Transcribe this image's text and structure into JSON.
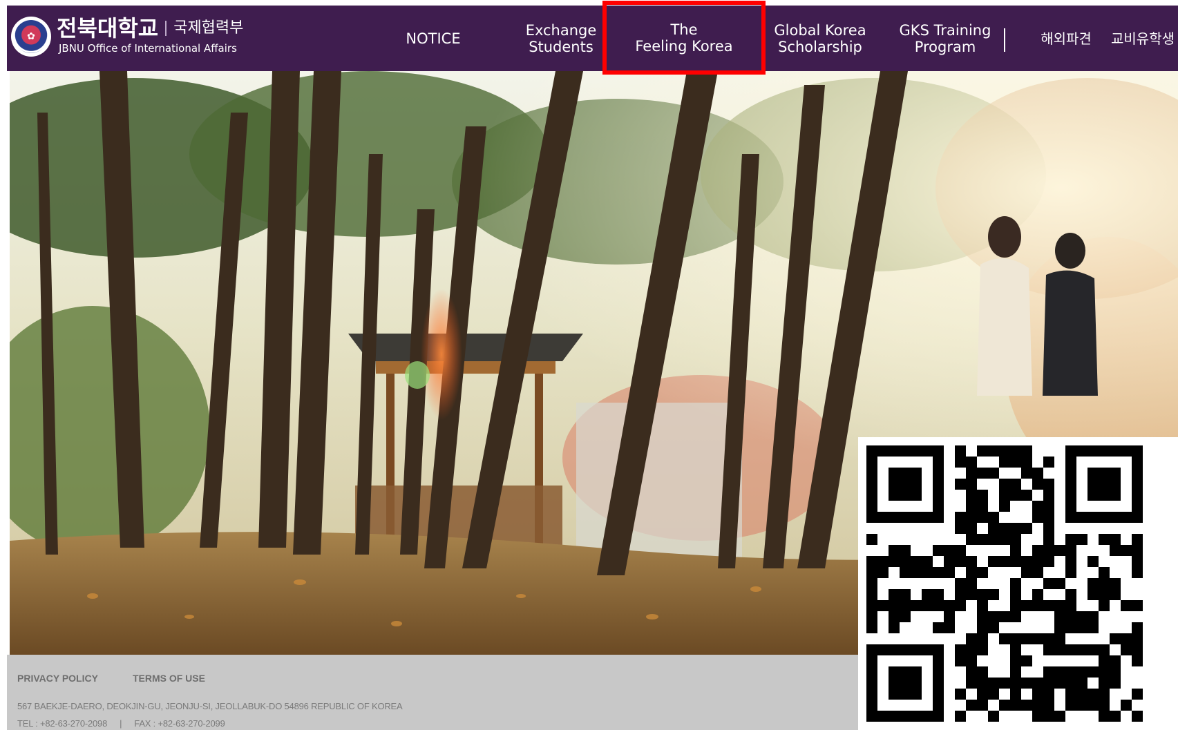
{
  "header": {
    "logo": {
      "univ_name": "전북대학교",
      "dept_name": "국제협력부",
      "english_name": "JBNU Office of International Affairs",
      "emblem_icon": "university-emblem-icon"
    },
    "nav": [
      {
        "label": "NOTICE"
      },
      {
        "label": "Exchange\nStudents"
      },
      {
        "label": "The\nFeeling Korea",
        "highlighted": true
      },
      {
        "label": "Global Korea\nScholarship"
      },
      {
        "label": "GKS Training\nProgram"
      },
      {
        "label": "해외파견"
      },
      {
        "label": "교비유학생"
      }
    ]
  },
  "hero": {
    "image": "campus-forest-photo"
  },
  "footer": {
    "links": [
      "PRIVACY POLICY",
      "TERMS OF USE"
    ],
    "address": "567 BAEKJE-DAERO, DEOKJIN-GU, JEONJU-SI, JEOLLABUK-DO 54896 REPUBLIC OF KOREA",
    "tel": "TEL : +82-63-270-2098",
    "separator": "|",
    "fax": "FAX : +82-63-270-2099"
  },
  "qr": {
    "icon": "qr-code-icon"
  },
  "colors": {
    "header_bg": "#3f1d4f",
    "footer_bg": "#c8c8c8",
    "highlight": "#ff0000"
  }
}
